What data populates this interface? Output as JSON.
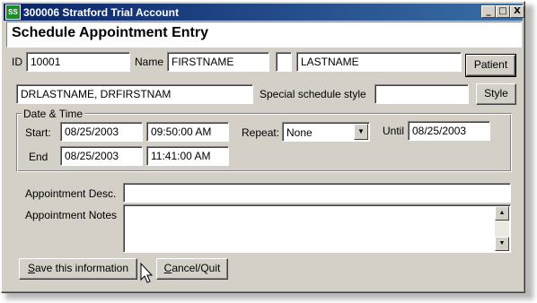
{
  "window": {
    "title": "300006 Stratford Trial Account",
    "icon_text": "SS",
    "minimize_glyph": "_",
    "maximize_glyph": "□",
    "close_glyph": "X"
  },
  "header": {
    "title": "Schedule Appointment Entry"
  },
  "patient": {
    "id_label": "ID",
    "id_value": "10001",
    "name_label": "Name",
    "first_name": "FIRSTNAME",
    "middle_initial": "",
    "last_name": "LASTNAME",
    "patient_button": "Patient"
  },
  "provider": {
    "doctor_value": "DRLASTNAME, DRFIRSTNAM",
    "style_label": "Special schedule style",
    "style_value": "",
    "style_button": "Style"
  },
  "datetime": {
    "group_label": "Date & Time",
    "start_label": "Start:",
    "start_date": "08/25/2003",
    "start_time": "09:50:00 AM",
    "end_label": "End",
    "end_date": "08/25/2003",
    "end_time": "11:41:00 AM",
    "repeat_label": "Repeat:",
    "repeat_value": "None",
    "until_label": "Until",
    "until_date": "08/25/2003"
  },
  "appointment": {
    "desc_label": "Appointment Desc.",
    "desc_value": "",
    "notes_label": "Appointment Notes",
    "notes_value": ""
  },
  "actions": {
    "save_prefix": "S",
    "save_rest": "ave this information",
    "cancel_prefix": "C",
    "cancel_rest": "ancel/Quit"
  },
  "icons": {
    "app": "app-logo-icon",
    "dropdown": "chevron-down-icon",
    "scroll_up": "arrow-up-icon",
    "scroll_down": "arrow-down-icon",
    "pointer": "mouse-pointer-icon"
  },
  "colors": {
    "titlebar_start": "#0a246a",
    "titlebar_end": "#3a6ea5",
    "face": "#d4d0c8"
  }
}
